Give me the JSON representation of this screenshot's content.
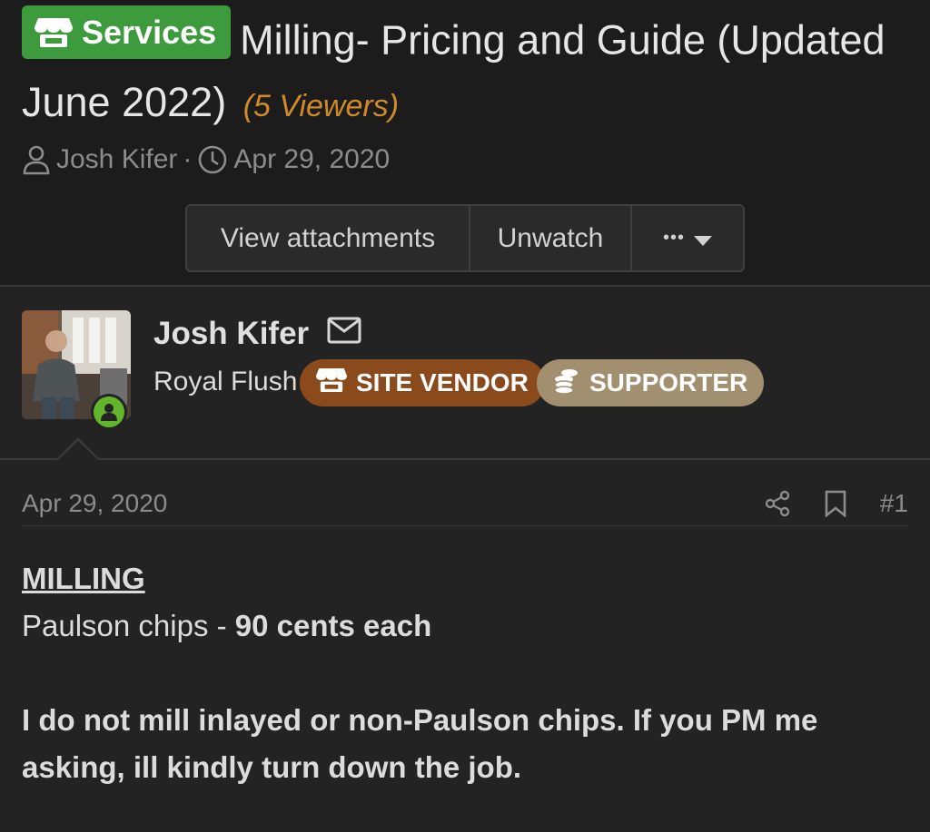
{
  "thread": {
    "prefix_label": "Services",
    "title": "Milling- Pricing and Guide (Updated June 2022)",
    "viewers": "(5 Viewers)",
    "author": "Josh Kifer",
    "separator": "·",
    "date": "Apr 29, 2020"
  },
  "buttons": {
    "attachments": "View attachments",
    "unwatch": "Unwatch",
    "more": "•••"
  },
  "user": {
    "name": "Josh Kifer",
    "title": "Royal Flush",
    "banners": [
      "SITE VENDOR",
      "SUPPORTER"
    ]
  },
  "post": {
    "date": "Apr 29, 2020",
    "number": "#1",
    "heading": "MILLING",
    "line1_normal": "Paulson chips - ",
    "line1_bold": "90 cents each",
    "paragraph": "I do not mill inlayed or non-Paulson chips. If you PM me asking, ill kindly turn down the job."
  },
  "colors": {
    "prefix_green": "#3d9a3d",
    "viewers_orange": "#d08a28",
    "vendor_brown": "#8b4a1c",
    "supporter_tan": "#a28f70",
    "online_green": "#63b52e"
  }
}
